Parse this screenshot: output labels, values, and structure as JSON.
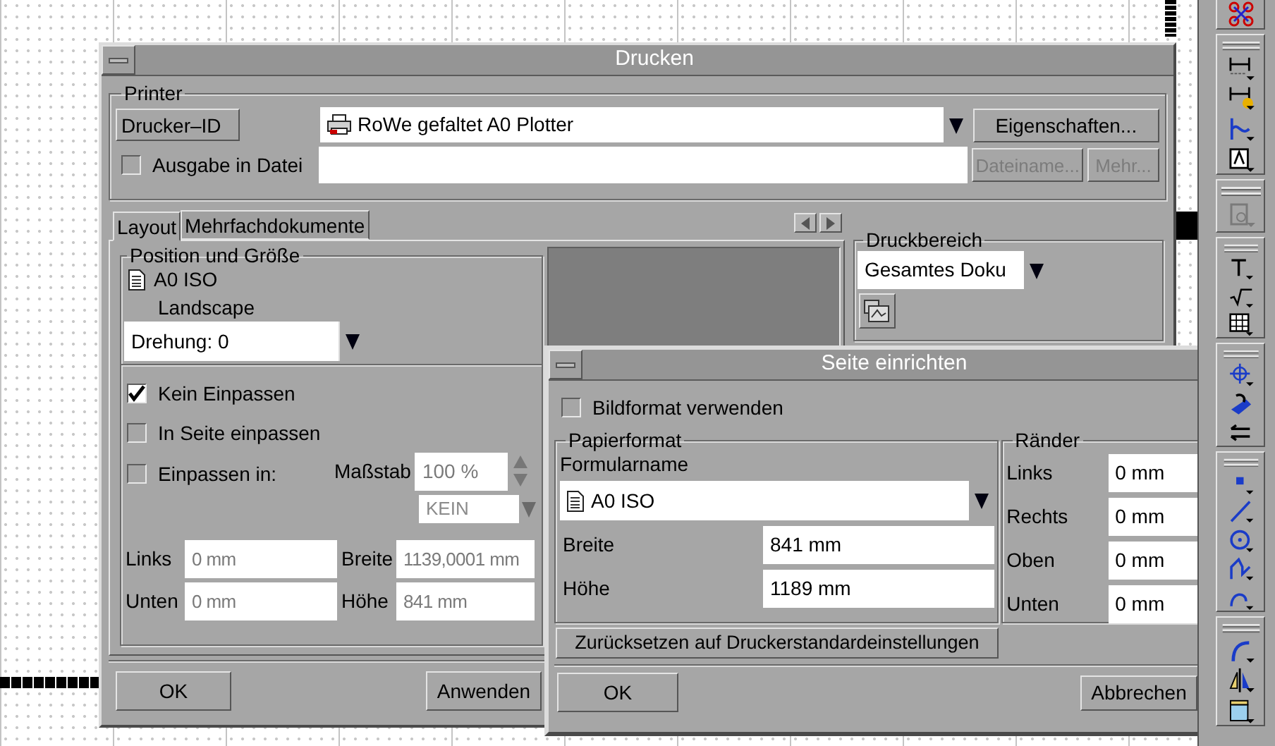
{
  "print_dialog": {
    "title": "Drucken",
    "printer": {
      "legend": "Printer",
      "id_button": "Drucker–ID",
      "printer_select": "RoWe gefaltet A0 Plotter",
      "properties_button": "Eigenschaften...",
      "output_to_file": {
        "label": "Ausgabe in Datei",
        "checked": false
      },
      "file_buttons": [
        {
          "label": "Dateiname...",
          "disabled": true
        },
        {
          "label": "Mehr...",
          "disabled": true
        }
      ]
    },
    "tabs": [
      {
        "label": "Layout",
        "selected": true
      },
      {
        "label": "Mehrfachdokumente",
        "selected": false
      }
    ],
    "position": {
      "legend": "Position und Größe",
      "paper": "A0 ISO",
      "orientation": "Landscape",
      "rotation_select": "Drehung: 0",
      "fit_options": [
        {
          "label": "Kein Einpassen",
          "checked": true
        },
        {
          "label": "In Seite einpassen",
          "checked": false
        },
        {
          "label": "Einpassen in:",
          "checked": false
        }
      ],
      "scale": {
        "label": "Maßstab",
        "value": "100 %",
        "unit": "KEIN",
        "disabled": true
      },
      "fields": [
        {
          "label": "Links",
          "value": "0 mm",
          "disabled": true
        },
        {
          "label": "Breite",
          "value": "1139,0001 mm",
          "disabled": true
        },
        {
          "label": "Unten",
          "value": "0 mm",
          "disabled": true
        },
        {
          "label": "Höhe",
          "value": "841 mm",
          "disabled": true
        }
      ]
    },
    "print_range": {
      "legend": "Druckbereich",
      "select": "Gesamtes Doku"
    },
    "buttons": [
      "OK",
      "Anwenden"
    ]
  },
  "page_setup_dialog": {
    "title": "Seite einrichten",
    "image_format": {
      "label": "Bildformat verwenden",
      "checked": false
    },
    "paper_format": {
      "legend": "Papierformat",
      "form_label": "Formularname",
      "form_select": "A0 ISO",
      "fields": [
        {
          "label": "Breite",
          "value": "841 mm"
        },
        {
          "label": "Höhe",
          "value": "1189 mm"
        }
      ]
    },
    "margins": {
      "legend": "Ränder",
      "fields": [
        {
          "label": "Links",
          "value": "0 mm"
        },
        {
          "label": "Rechts",
          "value": "0 mm"
        },
        {
          "label": "Oben",
          "value": "0 mm"
        },
        {
          "label": "Unten",
          "value": "0 mm"
        }
      ]
    },
    "reset_button": "Zurücksetzen auf Druckerstandardeinstellungen",
    "buttons": [
      "OK",
      "Abbrechen"
    ]
  }
}
